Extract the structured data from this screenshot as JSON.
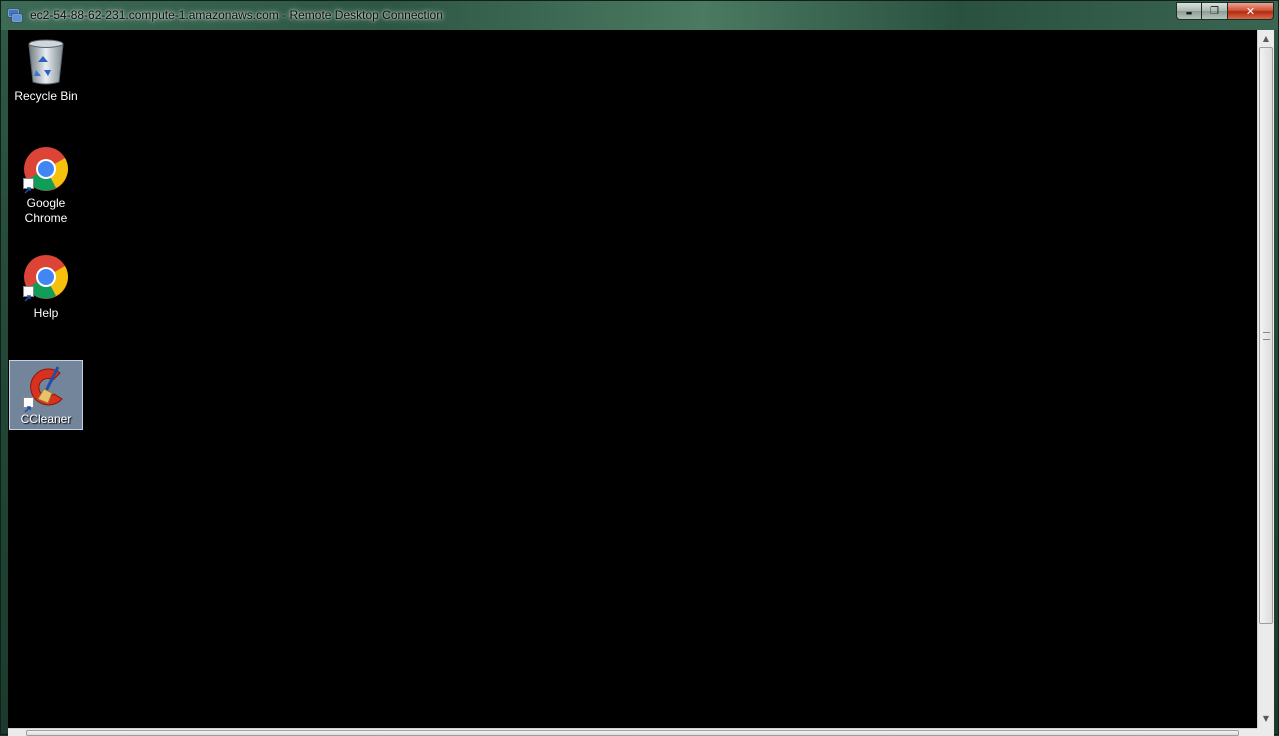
{
  "window": {
    "title": "ec2-54-88-62-231.compute-1.amazonaws.com - Remote Desktop Connection",
    "controls": {
      "minimize": "▬",
      "maximize": "❐",
      "close": "✕"
    }
  },
  "desktop": {
    "icons": [
      {
        "label": "Recycle Bin",
        "icon": "recycle-bin-icon"
      },
      {
        "label": "Google Chrome",
        "icon": "chrome-icon"
      },
      {
        "label": "Help",
        "icon": "chrome-icon"
      },
      {
        "label": "CCleaner",
        "icon": "ccleaner-icon",
        "selected": true
      }
    ]
  },
  "scrollbar": {
    "up": "▲",
    "down": "▼",
    "left": "◀",
    "right": "▶"
  }
}
